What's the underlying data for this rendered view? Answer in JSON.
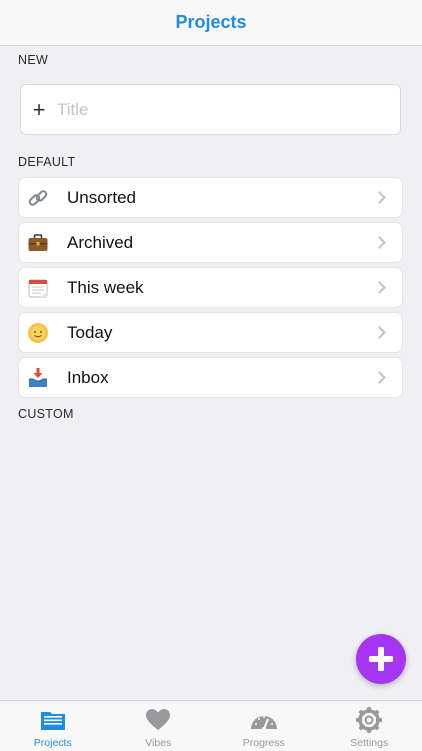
{
  "navbar": {
    "title": "Projects"
  },
  "sections": {
    "new": "NEW",
    "default": "DEFAULT",
    "custom": "CUSTOM"
  },
  "new_project": {
    "placeholder": "Title",
    "value": ""
  },
  "default_items": [
    {
      "label": "Unsorted",
      "icon": "link-icon"
    },
    {
      "label": "Archived",
      "icon": "briefcase-icon"
    },
    {
      "label": "This week",
      "icon": "calendar-icon"
    },
    {
      "label": "Today",
      "icon": "sun-icon"
    },
    {
      "label": "Inbox",
      "icon": "inbox-tray-icon"
    }
  ],
  "fab": {
    "icon": "plus-icon",
    "color": "#a535f0"
  },
  "tabs": [
    {
      "label": "Projects",
      "icon": "folder-icon",
      "active": true
    },
    {
      "label": "Vibes",
      "icon": "heart-icon",
      "active": false
    },
    {
      "label": "Progress",
      "icon": "gauge-icon",
      "active": false
    },
    {
      "label": "Settings",
      "icon": "gear-icon",
      "active": false
    }
  ],
  "colors": {
    "accent": "#1f8ee0",
    "inactive": "#9a9a9e",
    "background": "#efeff4"
  }
}
